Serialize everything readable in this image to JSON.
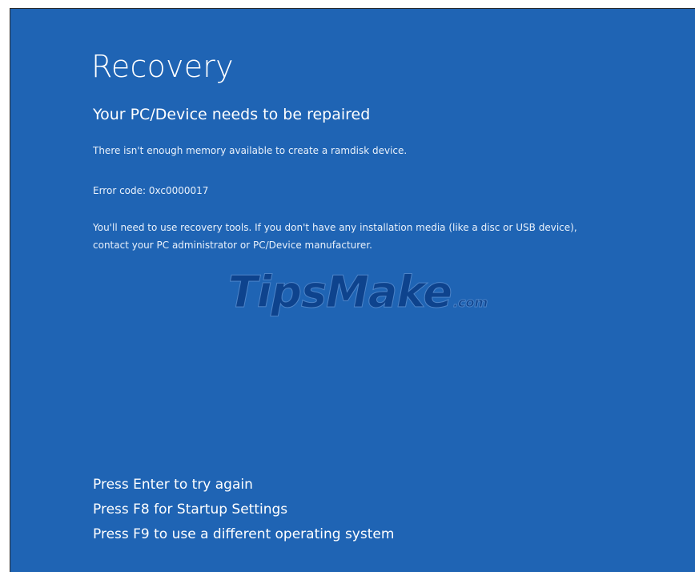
{
  "screen": {
    "title": "Recovery",
    "subtitle": "Your PC/Device needs to be repaired",
    "message": "There isn't enough memory available to create a ramdisk device.",
    "error_code": "Error code: 0xc0000017",
    "help_text": "You'll need to use recovery tools. If you don't have any installation media (like a disc or USB device), contact your PC administrator or PC/Device manufacturer.",
    "options": [
      "Press Enter to try again",
      "Press F8 for Startup Settings",
      "Press F9 to use a different operating system"
    ],
    "background_color": "#1f64b4"
  },
  "watermark": {
    "main": "TipsMake",
    "suffix": ".com"
  }
}
